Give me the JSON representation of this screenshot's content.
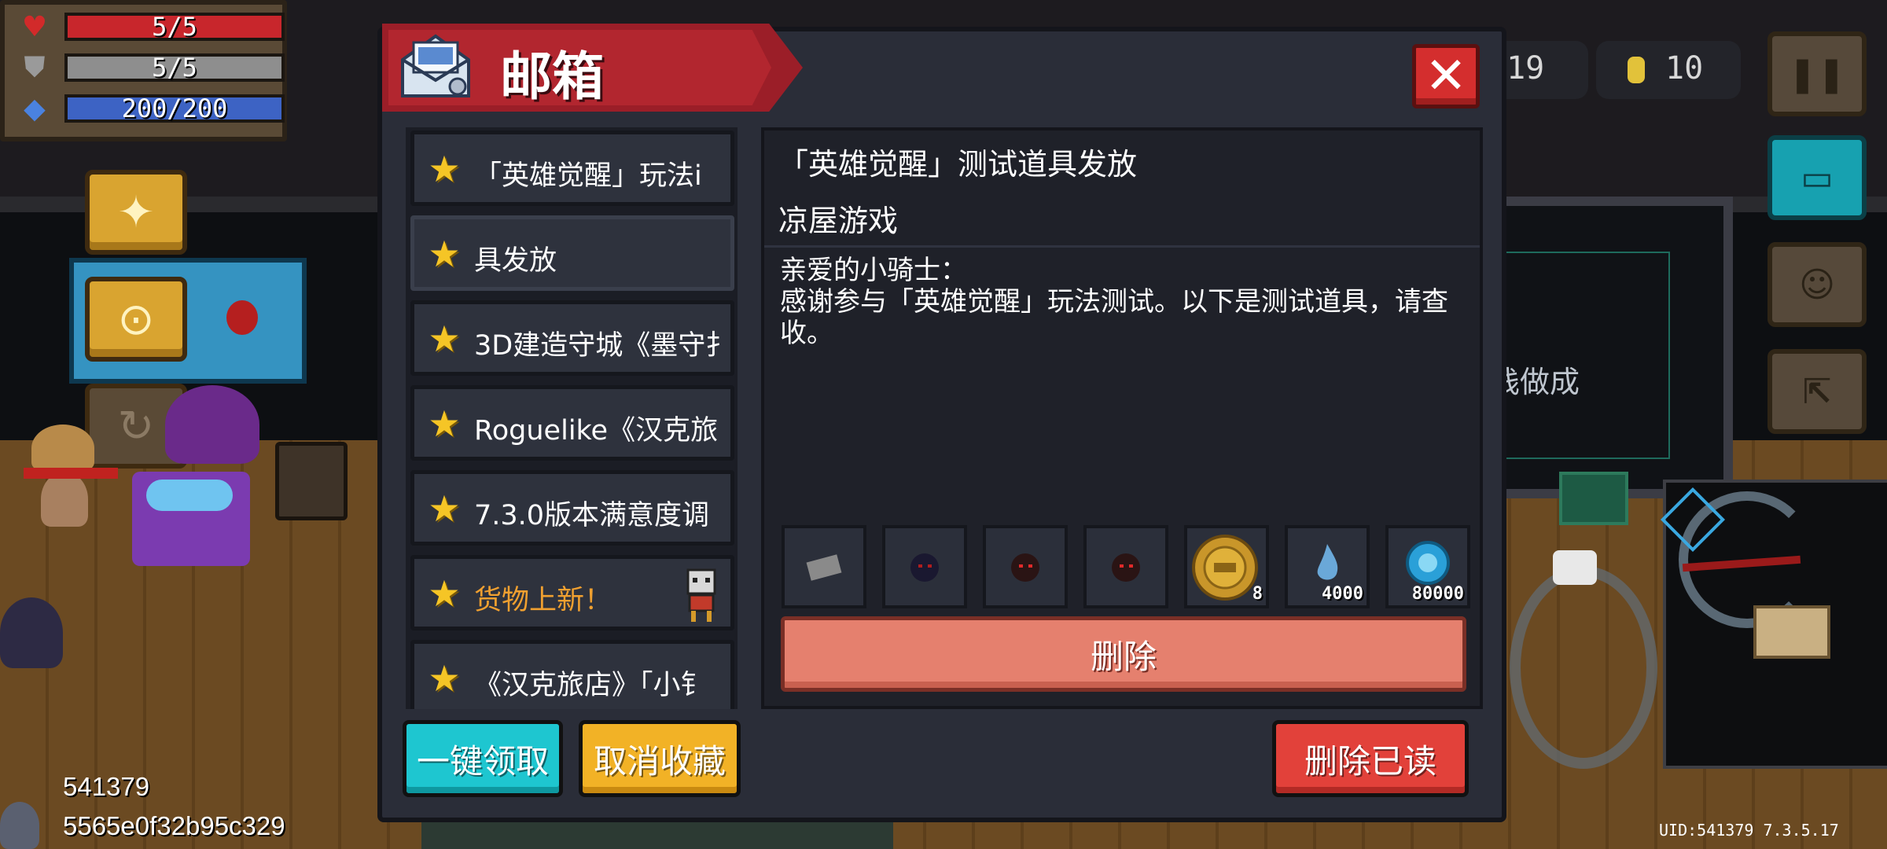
{
  "hud": {
    "health": {
      "text": "5/5",
      "level": 1.0,
      "color": "#c8262c",
      "icon": "heart-icon"
    },
    "armor": {
      "text": "5/5",
      "level": 1.0,
      "color": "#8e8e8e",
      "icon": "shield-icon"
    },
    "energy": {
      "text": "200/200",
      "level": 1.0,
      "color": "#3d63c4",
      "icon": "diamond-icon"
    }
  },
  "top_right": {
    "gems_partial": "019",
    "coins": "10",
    "pause_icon": "pause-icon",
    "controller_icon": "controller-icon",
    "profile_icon": "profile-icon",
    "exit_icon": "exit-icon"
  },
  "scene": {
    "partial_text": "栈做成"
  },
  "dialog": {
    "title": "邮箱",
    "mail_icon": "mail-icon",
    "close_label": "✕",
    "list": [
      {
        "label": "「英雄觉醒」玩法i",
        "star": "★",
        "highlight": false
      },
      {
        "label": "具发放",
        "star": "★",
        "highlight": false
      },
      {
        "label": "3D建造守城《墨守扌",
        "star": "★",
        "highlight": false
      },
      {
        "label": "Roguelike《汉克旅",
        "star": "★",
        "highlight": false
      },
      {
        "label": "7.3.0版本满意度调",
        "star": "★",
        "highlight": false
      },
      {
        "label": "货物上新！",
        "star": "★",
        "highlight": true
      },
      {
        "label": "《汉克旅店》「小钅",
        "star": "★",
        "highlight": false
      }
    ],
    "detail": {
      "title": "「英雄觉醒」测试道具发放",
      "sender": "凉屋游戏",
      "body_line1": "亲爱的小骑士：",
      "body_line2": "感谢参与「英雄觉醒」玩法测试。以下是测试道具，请查收。",
      "items": [
        {
          "icon": "scroll-icon",
          "qty": ""
        },
        {
          "icon": "dark-orb-icon",
          "qty": ""
        },
        {
          "icon": "red-eyed-creature-icon",
          "qty": ""
        },
        {
          "icon": "red-eyed-creature-icon",
          "qty": ""
        },
        {
          "icon": "gold-coin-icon",
          "qty": "8"
        },
        {
          "icon": "blue-flame-icon",
          "qty": "4000"
        },
        {
          "icon": "blue-gem-icon",
          "qty": "80000"
        }
      ],
      "delete_label": "删除"
    },
    "footer": {
      "claim_all": "一键领取",
      "unfavorite": "取消收藏",
      "delete_read": "删除已读"
    }
  },
  "debug": {
    "line1": "541379",
    "line2": "5565e0f32b95c329",
    "uid": "UID:541379 7.3.5.17"
  }
}
